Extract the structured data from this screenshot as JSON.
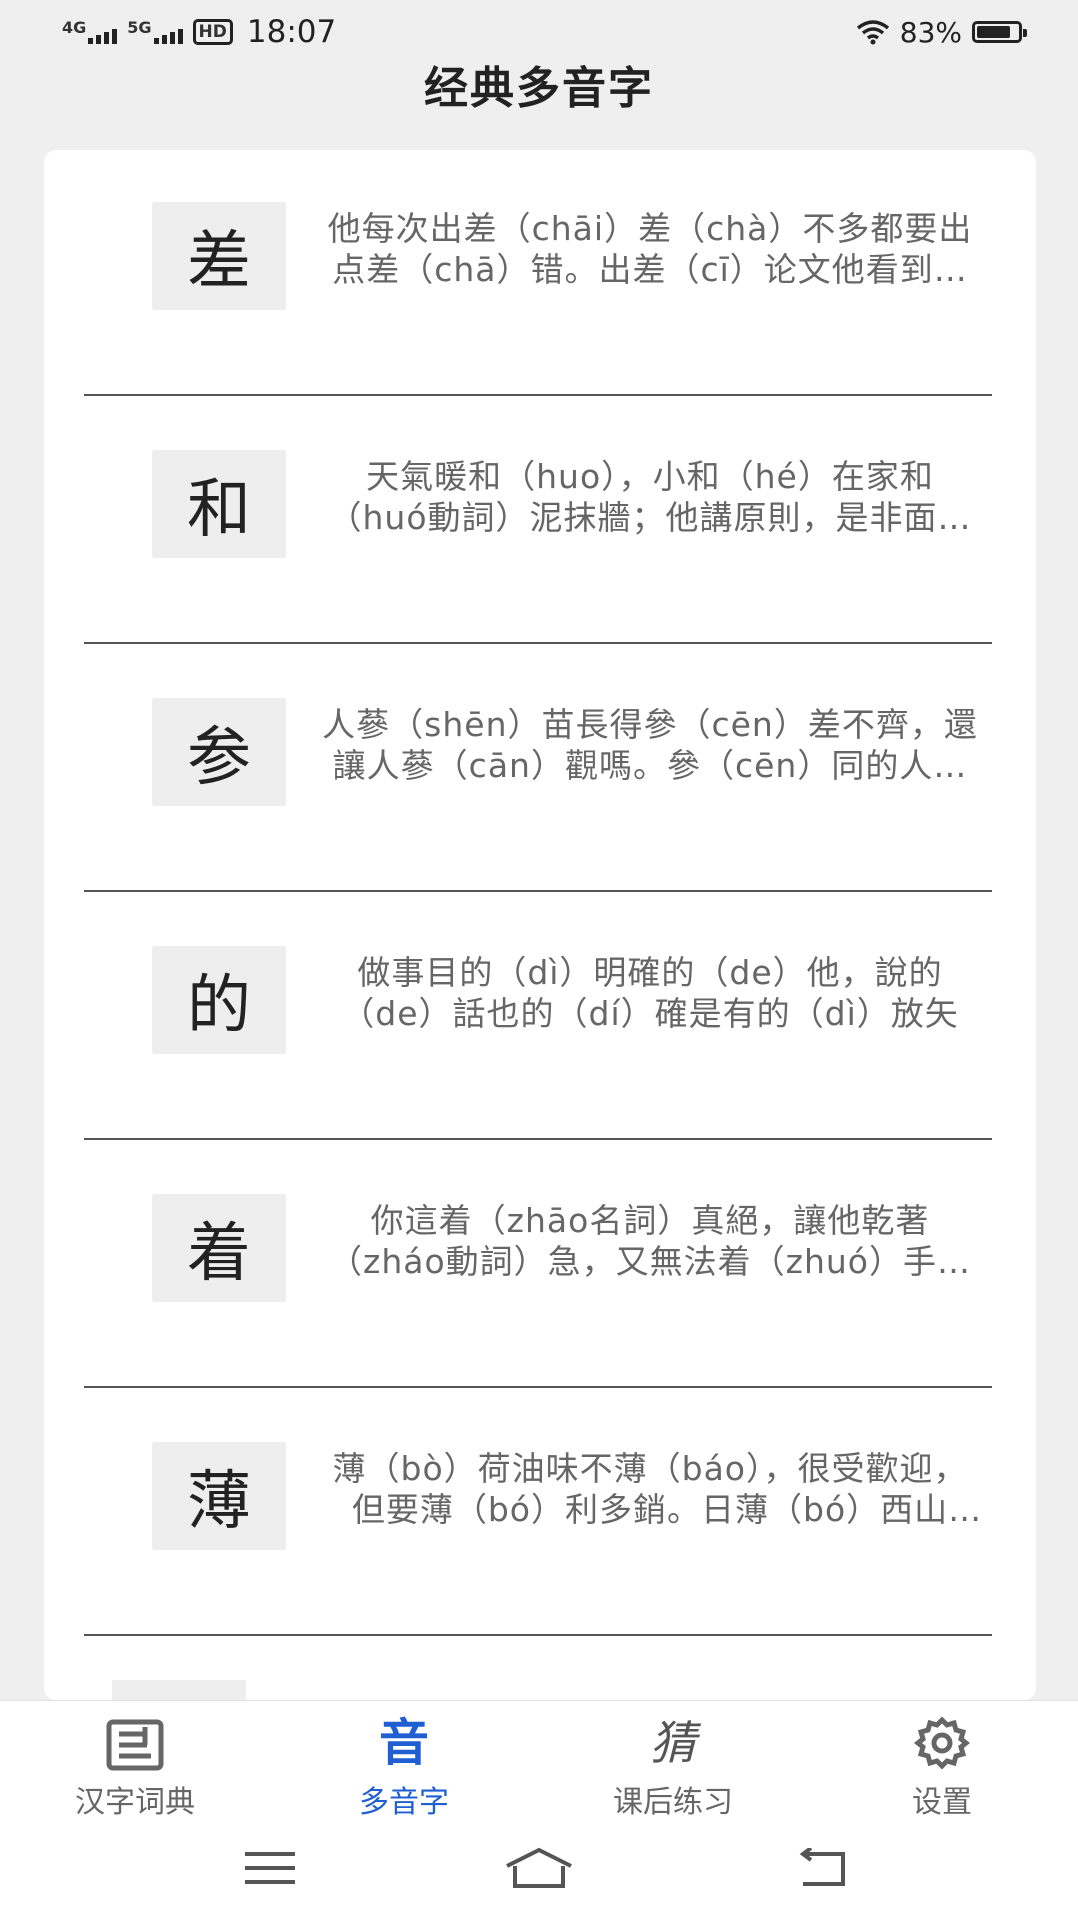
{
  "status_bar": {
    "network_1": "4G",
    "network_2": "5G",
    "hd_label": "HD",
    "time": "18:07",
    "battery_percent": "83%",
    "battery_level": 0.83
  },
  "header": {
    "title": "经典多音字"
  },
  "items": [
    {
      "char": "差",
      "text": "他每次出差（chāi）差（chà）不多都要出点差（chā）错。出差（cī）论文他看到以公职差前"
    },
    {
      "char": "和",
      "text": "天氣暖和（huo），小和（hé）在家和（huó動詞）泥抹牆；他講原則，是非面前從不和（hè）稀泥"
    },
    {
      "char": "参",
      "text": "人蔘（shēn）苗長得參（cēn）差不齊，還讓人蔘（cān）觀嗎。參（cēn）同的人蔘（shēn）樣品呈現"
    },
    {
      "char": "的",
      "text": "做事目的（dì）明確的（de）他，說的（de）話也的（dí）確是有的（dì）放矢"
    },
    {
      "char": "着",
      "text": "你這着（zhāo名詞）真絕，讓他乾著（zháo動詞）急，又無法着（zhuó）手應付，心裡老是懸着（zhe）"
    },
    {
      "char": "薄",
      "text": "薄（bò）荷油味不薄（báo），很受歡迎，但要薄（bó）利多銷。日薄（bó）西山時，他才有空薄（bó）嘗"
    }
  ],
  "tabs": [
    {
      "label": "汉字词典",
      "icon": "dictionary-icon"
    },
    {
      "label": "多音字",
      "icon": "polyphone-icon",
      "active": true,
      "glyph": "音"
    },
    {
      "label": "课后练习",
      "icon": "practice-icon",
      "glyph": "猜"
    },
    {
      "label": "设置",
      "icon": "settings-icon"
    }
  ],
  "colors": {
    "accent": "#1f5fd1",
    "background": "#efefef",
    "card": "#ffffff"
  }
}
